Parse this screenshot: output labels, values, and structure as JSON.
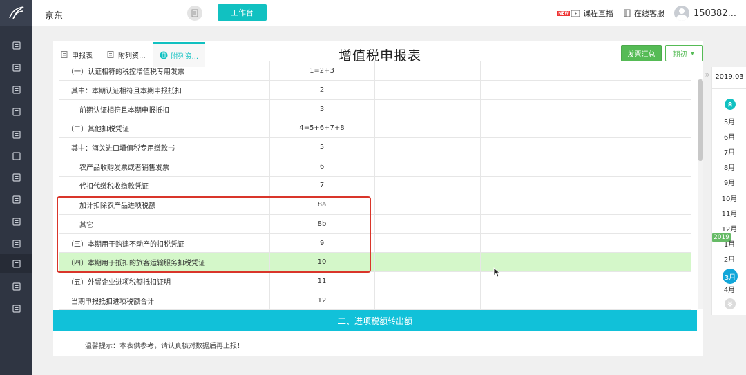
{
  "sidebar": {
    "icons": [
      "invoice-search-icon",
      "ledger-icon",
      "upload-doc-icon",
      "chart-icon",
      "building-icon",
      "calculator-icon",
      "voucher-icon",
      "tax-icon",
      "wallet-icon",
      "image-report-icon",
      "tax-declare-icon",
      "document-check-icon",
      "settings-icon"
    ],
    "active_index": 10
  },
  "topbar": {
    "company": "京东",
    "workbench_label": "工作台",
    "new_badge": "NEW",
    "course_live": "课程直播",
    "online_service": "在线客服",
    "user": "150382..."
  },
  "tabs": [
    {
      "label": "申报表",
      "active": false
    },
    {
      "label": "附列资...",
      "active": false
    },
    {
      "label": "附列资...",
      "active": true
    }
  ],
  "page_title": "增值税申报表",
  "buttons": {
    "invoice_summary": "发票汇总",
    "period": "期初"
  },
  "table": {
    "rows": [
      {
        "name": "（一）认证相符的税控增值税专用发票",
        "col": "1=2+3",
        "indent": 0
      },
      {
        "name": "其中：本期认证相符且本期申报抵扣",
        "col": "2",
        "indent": 1
      },
      {
        "name": "前期认证相符且本期申报抵扣",
        "col": "3",
        "indent": 2
      },
      {
        "name": "（二）其他扣税凭证",
        "col": "4=5+6+7+8",
        "indent": 0
      },
      {
        "name": "其中：海关进口增值税专用缴款书",
        "col": "5",
        "indent": 1
      },
      {
        "name": "农产品收购发票或者销售发票",
        "col": "6",
        "indent": 2
      },
      {
        "name": "代扣代缴税收缴款凭证",
        "col": "7",
        "indent": 2
      },
      {
        "name": "加计扣除农产品进项税额",
        "col": "8a",
        "indent": 2
      },
      {
        "name": "其它",
        "col": "8b",
        "indent": 2
      },
      {
        "name": "（三）本期用于购建不动产的扣税凭证",
        "col": "9",
        "indent": 0
      },
      {
        "name": "（四）本期用于抵扣的旅客运输服务扣税凭证",
        "col": "10",
        "indent": 0,
        "highlight": true
      },
      {
        "name": "（五）外贸企业进项税额抵扣证明",
        "col": "11",
        "indent": 0
      },
      {
        "name": "当期申报抵扣进项税额合计",
        "col": "12",
        "indent": 1
      }
    ]
  },
  "section_header": "二、进项税额转出额",
  "hint": "温馨提示：本表供参考，请认真核对数据后再上报！",
  "month_panel": {
    "period": "2019.03",
    "months": [
      "5月",
      "6月",
      "7月",
      "8月",
      "9月",
      "10月",
      "11月",
      "12月",
      "1月",
      "2月",
      "3月",
      "4月"
    ],
    "active_month": "3月",
    "year_badge": "2019"
  },
  "colors": {
    "accent": "#11c1c1",
    "highlight_row": "#d4f7c9",
    "green_button": "#55bb55",
    "red_box": "#d9352a"
  }
}
